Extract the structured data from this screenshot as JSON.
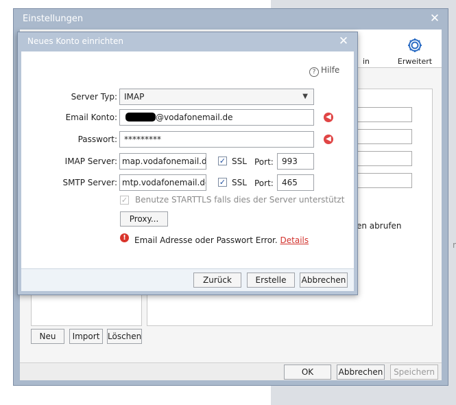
{
  "settings_window": {
    "title": "Einstellungen",
    "toolbar": {
      "partial_label": "in",
      "erweitert_label": "Erweitert"
    },
    "right_panel_text": "en abrufen",
    "account_buttons": {
      "new": "Neu",
      "import": "Import",
      "delete": "Löschen"
    },
    "footer_buttons": {
      "ok": "OK",
      "cancel": "Abbrechen",
      "save": "Speichern"
    },
    "background_stub": "m"
  },
  "dialog": {
    "title": "Neues Konto einrichten",
    "help": "Hilfe",
    "server_type": {
      "label": "Server Typ:",
      "value": "IMAP"
    },
    "email": {
      "label": "Email Konto:",
      "suffix": "@vodafonemail.de"
    },
    "password": {
      "label": "Passwort:",
      "value": "*********"
    },
    "imap": {
      "label": "IMAP Server:",
      "value": "map.vodafonemail.de",
      "ssl_label": "SSL",
      "port_label": "Port:",
      "port": "993"
    },
    "smtp": {
      "label": "SMTP Server:",
      "value": "mtp.vodafonemail.de",
      "ssl_label": "SSL",
      "port_label": "Port:",
      "port": "465"
    },
    "starttls_label": "Benutze STARTTLS falls dies der Server unterstützt",
    "proxy_button": "Proxy...",
    "error_text": "Email Adresse oder Passwort Error.",
    "error_link": "Details",
    "buttons": {
      "back": "Zurück",
      "create": "Erstelle",
      "cancel": "Abbrechen"
    }
  },
  "colors": {
    "titlebar": "#aab9cc",
    "error_red": "#e04545",
    "link_red": "#d2322d",
    "checkbox_blue": "#1f4fa0"
  },
  "icons": [
    "close-icon",
    "gear-icon",
    "help-icon",
    "chevron-down-icon",
    "error-icon",
    "checkmark-icon",
    "warning-icon"
  ]
}
